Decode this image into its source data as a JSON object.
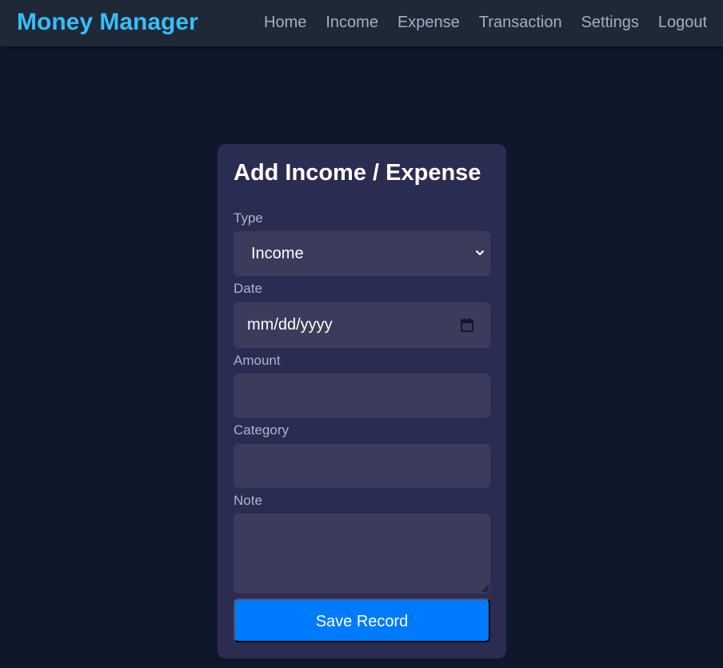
{
  "app": {
    "brand": "Money Manager"
  },
  "nav": {
    "links": [
      "Home",
      "Income",
      "Expense",
      "Transaction",
      "Settings",
      "Logout"
    ]
  },
  "form": {
    "title": "Add Income / Expense",
    "type_label": "Type",
    "type_value": "Income",
    "date_label": "Date",
    "date_placeholder": "mm/dd/yyyy",
    "amount_label": "Amount",
    "amount_value": "",
    "category_label": "Category",
    "category_value": "",
    "note_label": "Note",
    "note_value": "",
    "save_label": "Save Record"
  },
  "icons": {
    "select": "chevron-down-icon",
    "date": "calendar-icon",
    "textarea": "resize-handle-icon"
  },
  "colors": {
    "background": "#0f172a",
    "navbar": "#1e2837",
    "brand": "#38bdf8",
    "card": "#2b2c52",
    "field": "#3b3c5c",
    "primary_button": "#007bff"
  }
}
